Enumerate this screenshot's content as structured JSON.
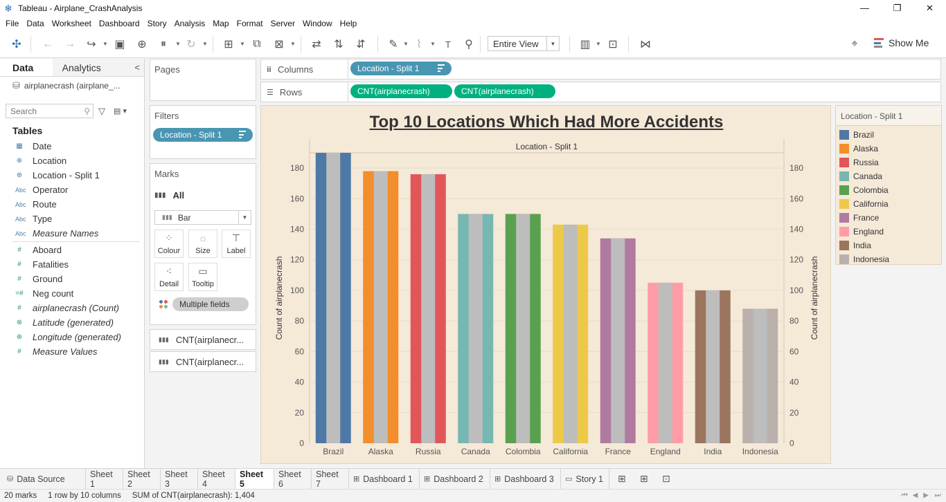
{
  "window": {
    "title": "Tableau - Airplane_CrashAnalysis",
    "minimize": "—",
    "restore": "❐",
    "close": "✕"
  },
  "menu": [
    "File",
    "Data",
    "Worksheet",
    "Dashboard",
    "Story",
    "Analysis",
    "Map",
    "Format",
    "Server",
    "Window",
    "Help"
  ],
  "toolbar": {
    "fit_value": "Entire View",
    "show_me_label": "Show Me"
  },
  "data_pane": {
    "tab_data": "Data",
    "tab_analytics": "Analytics",
    "data_source": "airplanecrash (airplane_...",
    "search_placeholder": "Search",
    "tables_heading": "Tables",
    "fields": [
      {
        "icon": "calendar",
        "type": "dimension",
        "name": "Date",
        "italic": false
      },
      {
        "icon": "globe",
        "type": "dimension",
        "name": "Location",
        "italic": false
      },
      {
        "icon": "globe",
        "type": "dimension",
        "name": "Location - Split 1",
        "italic": false
      },
      {
        "icon": "Abc",
        "type": "dimension",
        "name": "Operator",
        "italic": false
      },
      {
        "icon": "Abc",
        "type": "dimension",
        "name": "Route",
        "italic": false
      },
      {
        "icon": "Abc",
        "type": "dimension",
        "name": "Type",
        "italic": false
      },
      {
        "icon": "Abc",
        "type": "dimension",
        "name": "Measure Names",
        "italic": true
      },
      {
        "icon": "#",
        "type": "measure",
        "name": "Aboard",
        "italic": false
      },
      {
        "icon": "#",
        "type": "measure",
        "name": "Fatalities",
        "italic": false
      },
      {
        "icon": "#",
        "type": "measure",
        "name": "Ground",
        "italic": false
      },
      {
        "icon": "=#",
        "type": "measure",
        "name": "Neg count",
        "italic": false
      },
      {
        "icon": "#",
        "type": "measure",
        "name": "airplanecrash (Count)",
        "italic": true
      },
      {
        "icon": "globe",
        "type": "measure",
        "name": "Latitude (generated)",
        "italic": true
      },
      {
        "icon": "globe",
        "type": "measure",
        "name": "Longitude (generated)",
        "italic": true
      },
      {
        "icon": "#",
        "type": "measure",
        "name": "Measure Values",
        "italic": true
      }
    ]
  },
  "pages": {
    "heading": "Pages"
  },
  "filters": {
    "heading": "Filters",
    "pill": "Location - Split 1"
  },
  "marks": {
    "heading": "Marks",
    "all_label": "All",
    "mark_type": "Bar",
    "buttons": {
      "colour": "Colour",
      "size": "Size",
      "label": "Label",
      "detail": "Detail",
      "tooltip": "Tooltip"
    },
    "multiple_fields": "Multiple fields",
    "measure_cards": [
      "CNT(airplanecr...",
      "CNT(airplanecr..."
    ]
  },
  "shelves": {
    "columns_label": "Columns",
    "columns_pill": "Location - Split 1",
    "rows_label": "Rows",
    "rows_pills": [
      "CNT(airplanecrash)",
      "CNT(airplanecrash)"
    ]
  },
  "worksheet": {
    "title": "Top 10 Locations Which Had More Accidents",
    "header": "Location - Split 1",
    "bg": "#f5e9d8"
  },
  "chart_data": {
    "type": "bar",
    "title": "Top 10 Locations Which Had More Accidents",
    "xlabel": "Location - Split 1",
    "ylabel": "Count of airplanecrash",
    "y2label": "Count of airplanecrash",
    "ylim": [
      0,
      190
    ],
    "yticks": [
      0,
      20,
      40,
      60,
      80,
      100,
      120,
      140,
      160,
      180
    ],
    "grid": true,
    "legend_position": "right",
    "categories": [
      "Brazil",
      "Alaska",
      "Russia",
      "Canada",
      "Colombia",
      "California",
      "France",
      "England",
      "India",
      "Indonesia"
    ],
    "colors": [
      "#4e79a7",
      "#f28e2b",
      "#e15759",
      "#76b7b2",
      "#59a14f",
      "#edc948",
      "#b07aa1",
      "#ff9da7",
      "#9c755f",
      "#bab0ac"
    ],
    "overlay_color": "#bdbdbd",
    "series": [
      {
        "values": [
          190,
          178,
          176,
          150,
          150,
          143,
          134,
          105,
          100,
          88
        ]
      },
      {
        "values": [
          190,
          178,
          176,
          150,
          150,
          143,
          134,
          105,
          100,
          88
        ]
      }
    ]
  },
  "legend": {
    "title": "Location - Split 1",
    "items": [
      {
        "label": "Brazil",
        "color": "#4e79a7"
      },
      {
        "label": "Alaska",
        "color": "#f28e2b"
      },
      {
        "label": "Russia",
        "color": "#e15759"
      },
      {
        "label": "Canada",
        "color": "#76b7b2"
      },
      {
        "label": "Colombia",
        "color": "#59a14f"
      },
      {
        "label": "California",
        "color": "#edc948"
      },
      {
        "label": "France",
        "color": "#b07aa1"
      },
      {
        "label": "England",
        "color": "#ff9da7"
      },
      {
        "label": "India",
        "color": "#9c755f"
      },
      {
        "label": "Indonesia",
        "color": "#bab0ac"
      }
    ]
  },
  "tabs": [
    {
      "label": "Data Source",
      "icon": "db",
      "active": false
    },
    {
      "label": "Sheet 1",
      "icon": "",
      "active": false
    },
    {
      "label": "Sheet 2",
      "icon": "",
      "active": false
    },
    {
      "label": "Sheet 3",
      "icon": "",
      "active": false
    },
    {
      "label": "Sheet 4",
      "icon": "",
      "active": false
    },
    {
      "label": "Sheet 5",
      "icon": "",
      "active": true
    },
    {
      "label": "Sheet 6",
      "icon": "",
      "active": false
    },
    {
      "label": "Sheet 7",
      "icon": "",
      "active": false
    },
    {
      "label": "Dashboard 1",
      "icon": "dash",
      "active": false
    },
    {
      "label": "Dashboard 2",
      "icon": "dash",
      "active": false
    },
    {
      "label": "Dashboard 3",
      "icon": "dash",
      "active": false
    },
    {
      "label": "Story 1",
      "icon": "story",
      "active": false
    }
  ],
  "status": {
    "marks": "20 marks",
    "rows_cols": "1 row by 10 columns",
    "sum": "SUM of CNT(airplanecrash): 1,404"
  }
}
